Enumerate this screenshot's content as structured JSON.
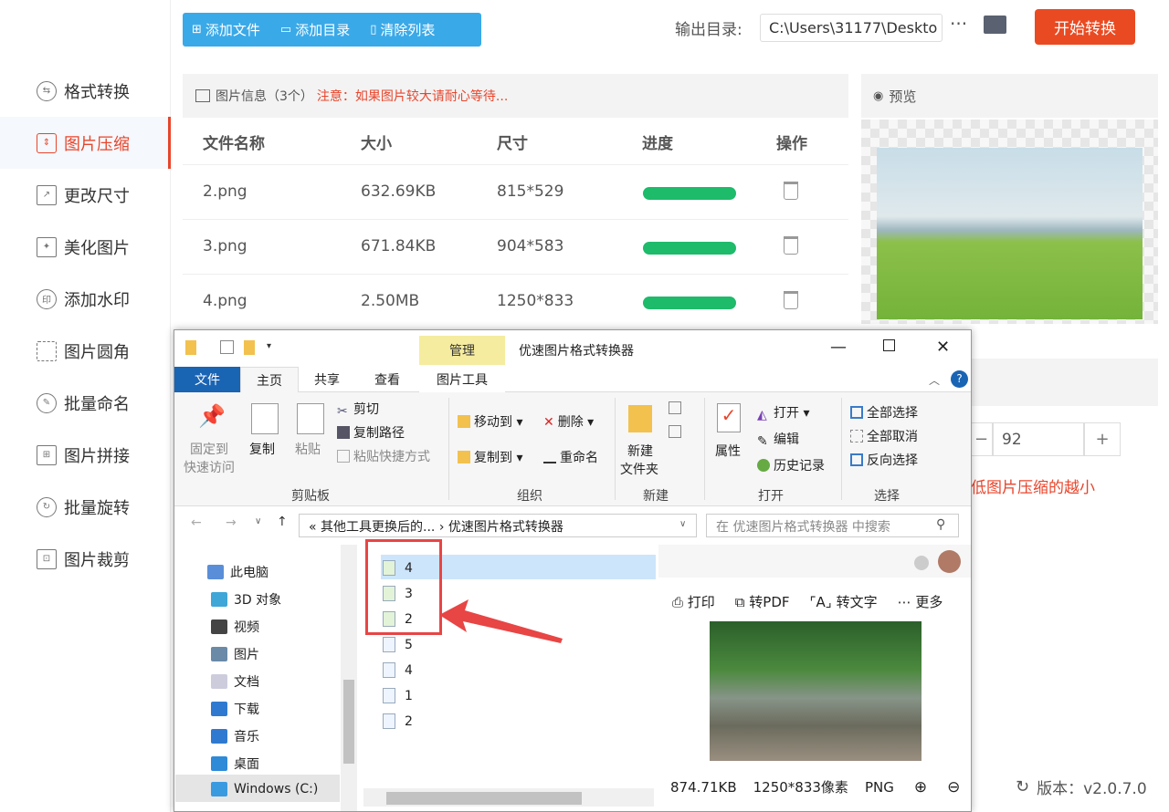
{
  "sidebar": {
    "items": [
      {
        "label": "格式转换",
        "icon": "format-convert-icon"
      },
      {
        "label": "图片压缩",
        "icon": "compress-icon",
        "active": true
      },
      {
        "label": "更改尺寸",
        "icon": "resize-icon"
      },
      {
        "label": "美化图片",
        "icon": "beautify-icon"
      },
      {
        "label": "添加水印",
        "icon": "watermark-icon"
      },
      {
        "label": "图片圆角",
        "icon": "rounded-corner-icon"
      },
      {
        "label": "批量命名",
        "icon": "rename-icon"
      },
      {
        "label": "图片拼接",
        "icon": "stitch-icon"
      },
      {
        "label": "批量旋转",
        "icon": "rotate-icon"
      },
      {
        "label": "图片裁剪",
        "icon": "crop-icon"
      }
    ]
  },
  "toolbar": {
    "add_file": "添加文件",
    "add_dir": "添加目录",
    "clear_list": "清除列表"
  },
  "output": {
    "label": "输出目录:",
    "path": "C:\\Users\\31177\\Deskto",
    "more": "···",
    "start": "开始转换"
  },
  "info": {
    "title": "图片信息（3个）",
    "warning": "注意：如果图片较大请耐心等待..."
  },
  "table": {
    "headers": [
      "文件名称",
      "大小",
      "尺寸",
      "进度",
      "操作"
    ],
    "rows": [
      {
        "name": "2.png",
        "size": "632.69KB",
        "dim": "815*529",
        "progress": 1.0
      },
      {
        "name": "3.png",
        "size": "671.84KB",
        "dim": "904*583",
        "progress": 1.0
      },
      {
        "name": "4.png",
        "size": "2.50MB",
        "dim": "1250*833",
        "progress": 1.0
      }
    ]
  },
  "preview": {
    "title": "预览"
  },
  "quality": {
    "minus": "−",
    "value": "92",
    "plus": "+",
    "hint": "低图片压缩的越小"
  },
  "version": "版本：v2.0.7.0",
  "explorer": {
    "manage_tab": "管理",
    "title": "优速图片格式转换器",
    "tabs": [
      "文件",
      "主页",
      "共享",
      "查看",
      "图片工具"
    ],
    "ribbon": {
      "pin": [
        "固定到",
        "快速访问"
      ],
      "copy": "复制",
      "paste": "粘贴",
      "cut": "剪切",
      "copy_path": "复制路径",
      "paste_shortcut": "粘贴快捷方式",
      "group_clipboard": "剪贴板",
      "move_to": "移动到",
      "copy_to": "复制到",
      "delete": "删除",
      "rename": "重命名",
      "group_organize": "组织",
      "new_folder": [
        "新建",
        "文件夹"
      ],
      "group_new": "新建",
      "properties": "属性",
      "open": "打开",
      "edit": "编辑",
      "history": "历史记录",
      "group_open": "打开",
      "select_all": "全部选择",
      "select_none": "全部取消",
      "invert": "反向选择",
      "group_select": "选择"
    },
    "address": "«  其他工具更换后的...  ›  优速图片格式转换器",
    "search_placeholder": "在 优速图片格式转换器 中搜索",
    "nav": [
      "此电脑",
      "3D 对象",
      "视频",
      "图片",
      "文档",
      "下载",
      "音乐",
      "桌面",
      "Windows (C:)"
    ],
    "files": [
      "4",
      "3",
      "2",
      "5",
      "4",
      "1",
      "2"
    ],
    "preview_tools": [
      "打印",
      "转PDF",
      "转文字",
      "更多"
    ],
    "preview_meta": {
      "size": "874.71KB",
      "dim": "1250*833像素",
      "type": "PNG"
    }
  },
  "colors": {
    "accent": "#e8452c",
    "toolbar": "#3aa9e8",
    "progress": "#1dbb6a",
    "start": "#ea4a22"
  }
}
